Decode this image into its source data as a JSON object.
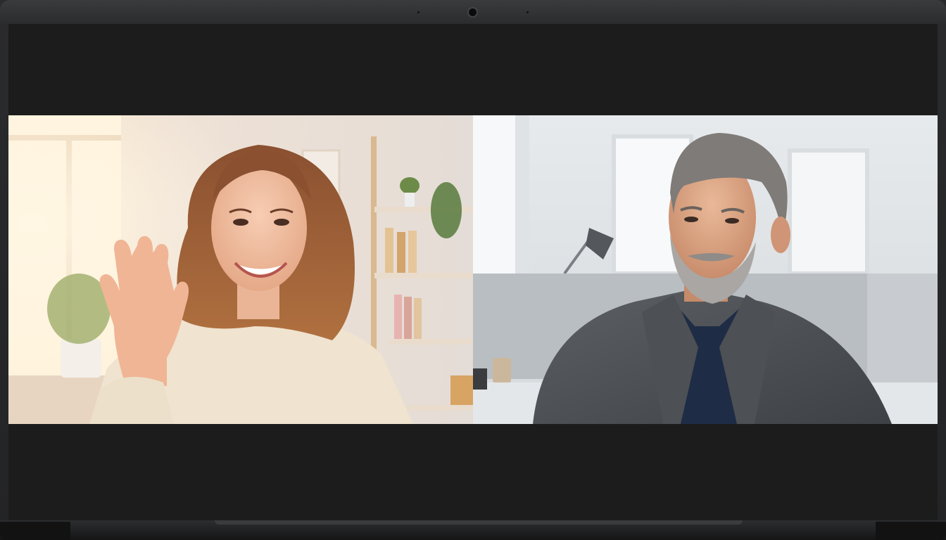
{
  "device": "laptop",
  "call": {
    "layout": "two-tile",
    "participants": [
      {
        "id": "participant-left",
        "description_icon": "woman-waving"
      },
      {
        "id": "participant-right",
        "description_icon": "man-in-blazer"
      }
    ]
  },
  "colors": {
    "screen_bg": "#1c1c1c",
    "bezel": "#2b2c2e"
  }
}
